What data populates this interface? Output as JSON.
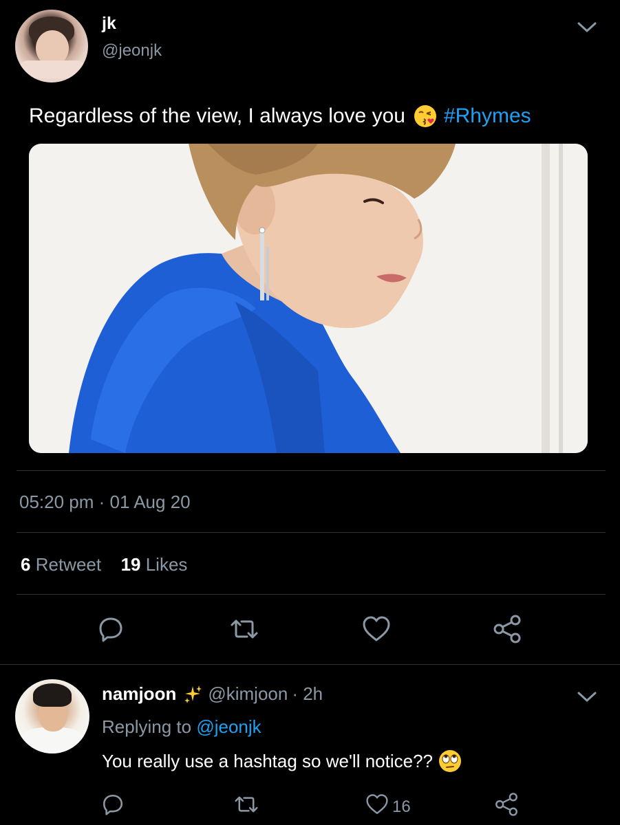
{
  "tweet": {
    "author_name": "jk",
    "author_handle": "@jeonjk",
    "text": "Regardless of the view, I always love you",
    "emoji": "kissing-heart",
    "hashtag": "#Rhymes",
    "timestamp": "05:20 pm · 01 Aug 20",
    "retweet_count": "6",
    "retweet_label": "Retweet",
    "like_count": "19",
    "like_label": "Likes",
    "actions": [
      "reply-icon",
      "retweet-icon",
      "like-icon",
      "share-icon"
    ]
  },
  "reply": {
    "author_name": "namjoon",
    "badge": "sparkles",
    "author_handle": "@kimjoon",
    "time": "· 2h",
    "replying_prefix": "Replying to",
    "replying_to": "@jeonjk",
    "text": "You really use a hashtag so we'll notice??",
    "emoji": "face-with-rolling-eyes",
    "like_count": "16",
    "actions": [
      "reply-icon",
      "retweet-icon",
      "like-icon",
      "share-icon"
    ]
  },
  "colors": {
    "background": "#000000",
    "text": "#ffffff",
    "secondary": "#8b98a5",
    "accent": "#1da1f2",
    "divider": "#2f3336"
  }
}
